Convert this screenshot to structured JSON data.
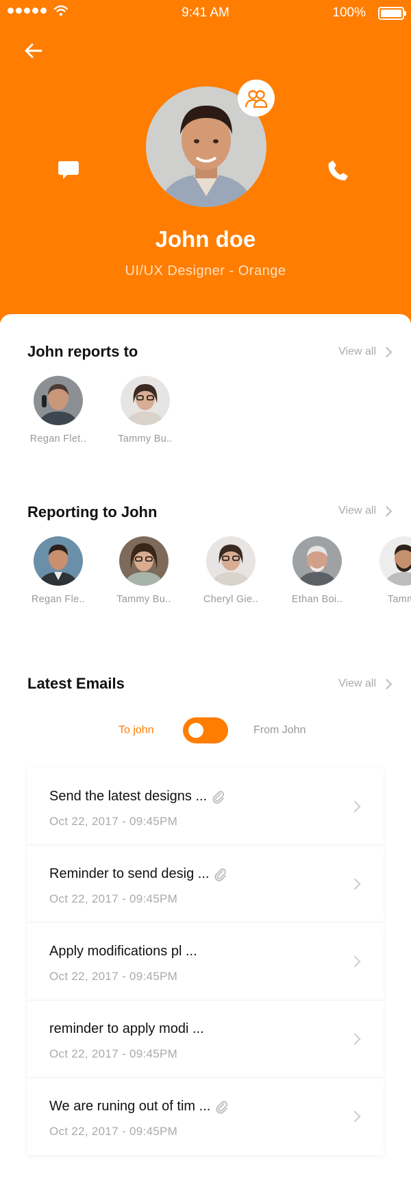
{
  "status_bar": {
    "time": "9:41 AM",
    "battery": "100%"
  },
  "profile": {
    "name": "John doe",
    "role": "UI/UX Designer - Orange"
  },
  "reports_to": {
    "title": "John reports to",
    "view_all": "View all",
    "people": [
      {
        "name": "Regan Flet.."
      },
      {
        "name": "Tammy Bu.."
      }
    ]
  },
  "reporting_to": {
    "title": "Reporting to John",
    "view_all": "View all",
    "people": [
      {
        "name": "Regan Fle.."
      },
      {
        "name": "Tammy Bu.."
      },
      {
        "name": "Cheryl Gie.."
      },
      {
        "name": "Ethan Boi.."
      },
      {
        "name": "Tammy"
      }
    ]
  },
  "emails": {
    "title": "Latest Emails",
    "view_all": "View all",
    "toggle_left": "To john",
    "toggle_right": "From John",
    "items": [
      {
        "subject": "Send the latest designs ...",
        "date": "Oct 22, 2017  -  09:45PM"
      },
      {
        "subject": "Reminder to send desig ...",
        "date": "Oct 22, 2017  -  09:45PM"
      },
      {
        "subject": "Apply modifications pl   ...",
        "date": "Oct 22, 2017  -  09:45PM"
      },
      {
        "subject": "reminder to apply modi ...",
        "date": "Oct 22, 2017  -  09:45PM"
      },
      {
        "subject": "We are runing out of tim ...",
        "date": "Oct 22, 2017  -  09:45PM"
      }
    ]
  },
  "colors": {
    "accent": "#FF7D00"
  },
  "icons": [
    "back-arrow-icon",
    "team-icon",
    "chat-icon",
    "phone-icon",
    "chevron-right-icon",
    "paperclip-icon"
  ]
}
